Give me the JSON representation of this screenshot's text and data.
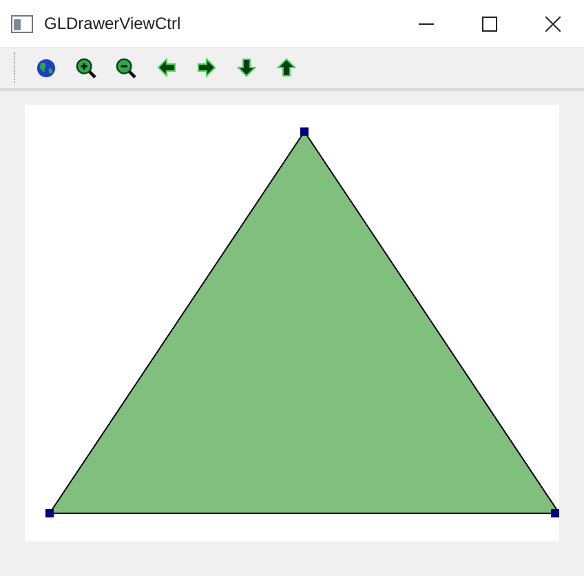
{
  "window": {
    "title": "GLDrawerViewCtrl"
  },
  "toolbar": [
    {
      "kind": "globe"
    },
    {
      "kind": "zoom-in"
    },
    {
      "kind": "zoom-out"
    },
    {
      "kind": "left"
    },
    {
      "kind": "right"
    },
    {
      "kind": "down"
    },
    {
      "kind": "up"
    }
  ]
}
